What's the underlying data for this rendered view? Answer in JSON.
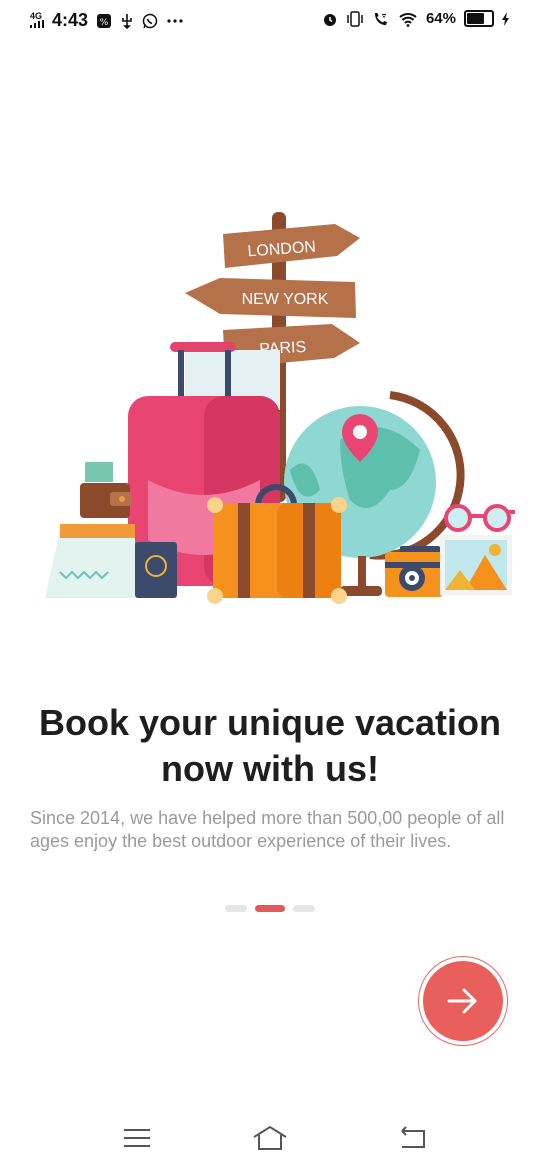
{
  "status_bar": {
    "network": "4G",
    "time": "4:43",
    "battery_percent": "64%",
    "battery_level": 0.64,
    "left_icons": [
      "photo-icon",
      "usb-icon",
      "whatsapp-icon",
      "more-dots-icon"
    ],
    "right_icons": [
      "alarm-icon",
      "vibrate-icon",
      "wifi-call-icon",
      "wifi-icon",
      "battery-icon",
      "charging-icon"
    ]
  },
  "illustration": {
    "signs": [
      "LONDON",
      "NEW YORK",
      "PARIS"
    ]
  },
  "onboarding": {
    "headline_line1": "Book your unique vacation",
    "headline_line2": "now with us!",
    "description": "Since 2014, we have helped more than 500,00 people of all ages enjoy the best outdoor experience of their lives.",
    "pager": {
      "total": 3,
      "active_index": 1
    }
  },
  "colors": {
    "accent": "#e85f5c",
    "headline": "#1e1e1e",
    "description": "#9a9a9a"
  },
  "navbar": {
    "icons": [
      "menu-icon",
      "home-icon",
      "back-icon"
    ]
  }
}
